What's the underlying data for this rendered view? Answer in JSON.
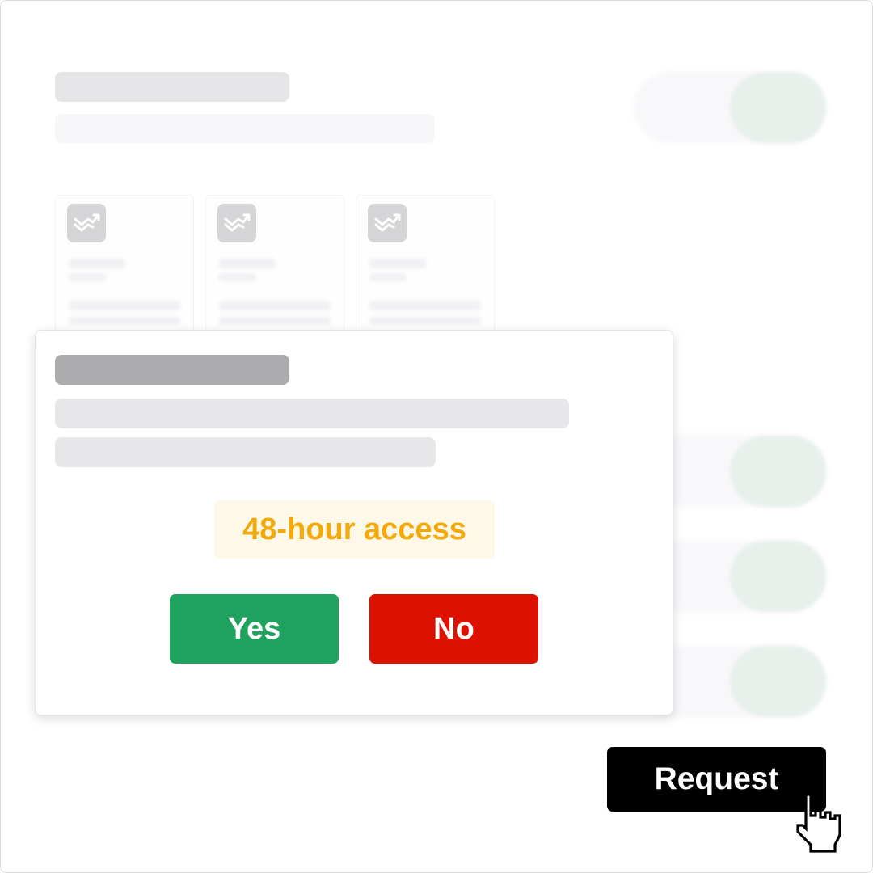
{
  "dialog": {
    "badge_text": "48-hour access",
    "yes_label": "Yes",
    "no_label": "No"
  },
  "actions": {
    "request_label": "Request"
  },
  "icons": {
    "card_icon": "trend-check-icon",
    "cursor": "hand-pointer-icon"
  },
  "colors": {
    "yes": "#1fa25e",
    "no": "#dd1100",
    "badge_text": "#f4a90b",
    "badge_bg": "#fef8e8",
    "request_bg": "#000000"
  }
}
